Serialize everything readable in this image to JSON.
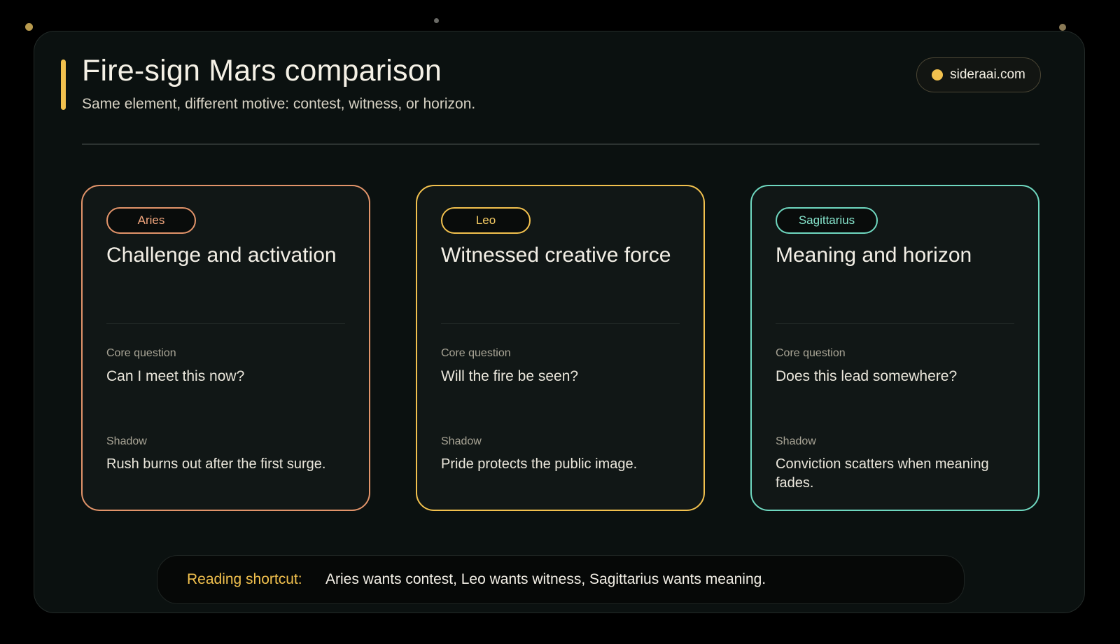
{
  "header": {
    "title": "Fire-sign Mars comparison",
    "subtitle": "Same element, different motive: contest, witness, or horizon.",
    "site": "sideraai.com"
  },
  "colors": {
    "accent": "#f2c14e",
    "aries": "#e2946a",
    "leo": "#f2c14e",
    "sagittarius": "#6fd8c0",
    "background": "#0b1110"
  },
  "cards": [
    {
      "sign": "Aries",
      "title": "Challenge and activation",
      "core_label": "Core question",
      "core_value": "Can I meet this now?",
      "shadow_label": "Shadow",
      "shadow_value": "Rush burns out after the first surge."
    },
    {
      "sign": "Leo",
      "title": "Witnessed creative force",
      "core_label": "Core question",
      "core_value": "Will the fire be seen?",
      "shadow_label": "Shadow",
      "shadow_value": "Pride protects the public image."
    },
    {
      "sign": "Sagittarius",
      "title": "Meaning and horizon",
      "core_label": "Core question",
      "core_value": "Does this lead somewhere?",
      "shadow_label": "Shadow",
      "shadow_value": "Conviction scatters when meaning fades."
    }
  ],
  "shortcut": {
    "label": "Reading shortcut:",
    "text": "Aries wants contest, Leo wants witness, Sagittarius wants meaning."
  }
}
